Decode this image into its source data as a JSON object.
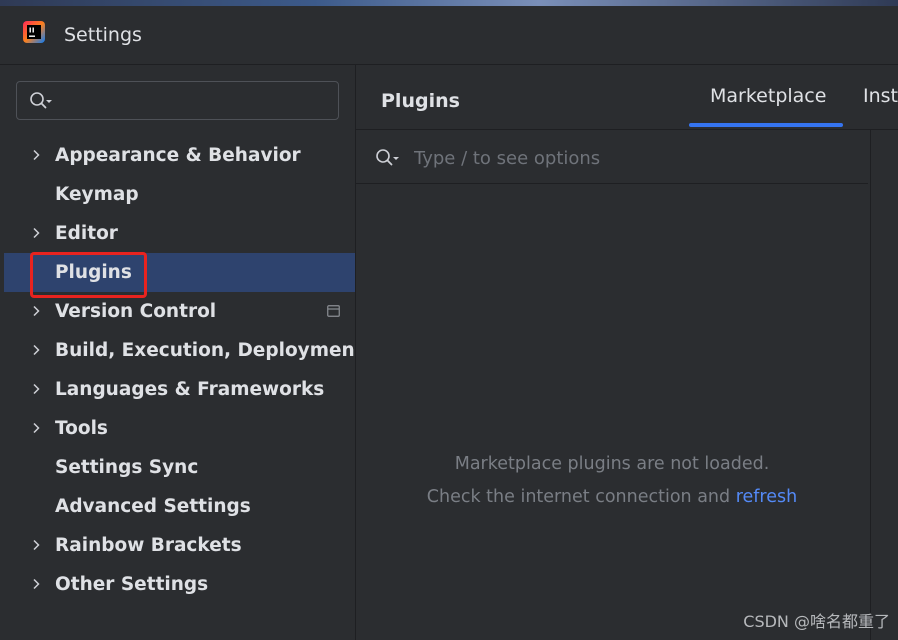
{
  "window": {
    "title": "Settings",
    "app_logo_icon": "intellij-logo-icon"
  },
  "sidebar": {
    "search": {
      "value": "",
      "placeholder": ""
    },
    "items": [
      {
        "label": "Appearance & Behavior",
        "expandable": true,
        "selected": false
      },
      {
        "label": "Keymap",
        "expandable": false,
        "selected": false
      },
      {
        "label": "Editor",
        "expandable": true,
        "selected": false
      },
      {
        "label": "Plugins",
        "expandable": false,
        "selected": true
      },
      {
        "label": "Version Control",
        "expandable": true,
        "selected": false,
        "trailing_icon": "project-scope-icon"
      },
      {
        "label": "Build, Execution, Deployment",
        "expandable": true,
        "selected": false
      },
      {
        "label": "Languages & Frameworks",
        "expandable": true,
        "selected": false
      },
      {
        "label": "Tools",
        "expandable": true,
        "selected": false
      },
      {
        "label": "Settings Sync",
        "expandable": false,
        "selected": false
      },
      {
        "label": "Advanced Settings",
        "expandable": false,
        "selected": false
      },
      {
        "label": "Rainbow Brackets",
        "expandable": true,
        "selected": false
      },
      {
        "label": "Other Settings",
        "expandable": true,
        "selected": false
      }
    ]
  },
  "main": {
    "title": "Plugins",
    "tabs": [
      {
        "label": "Marketplace",
        "active": true
      },
      {
        "label": "Insta",
        "active": false
      }
    ],
    "search": {
      "value": "",
      "placeholder": "Type / to see options"
    },
    "empty_state": {
      "line1": "Marketplace plugins are not loaded.",
      "line2_prefix": "Check the internet connection and ",
      "line2_link": "refresh"
    }
  },
  "watermark": "CSDN @啥名都重了",
  "colors": {
    "background": "#2b2d30",
    "selected_row": "#2e436e",
    "accent": "#3574f0",
    "link": "#548af7",
    "highlight": "#e8231f",
    "text": "#dfe1e5",
    "muted_text": "#7a7e85"
  }
}
